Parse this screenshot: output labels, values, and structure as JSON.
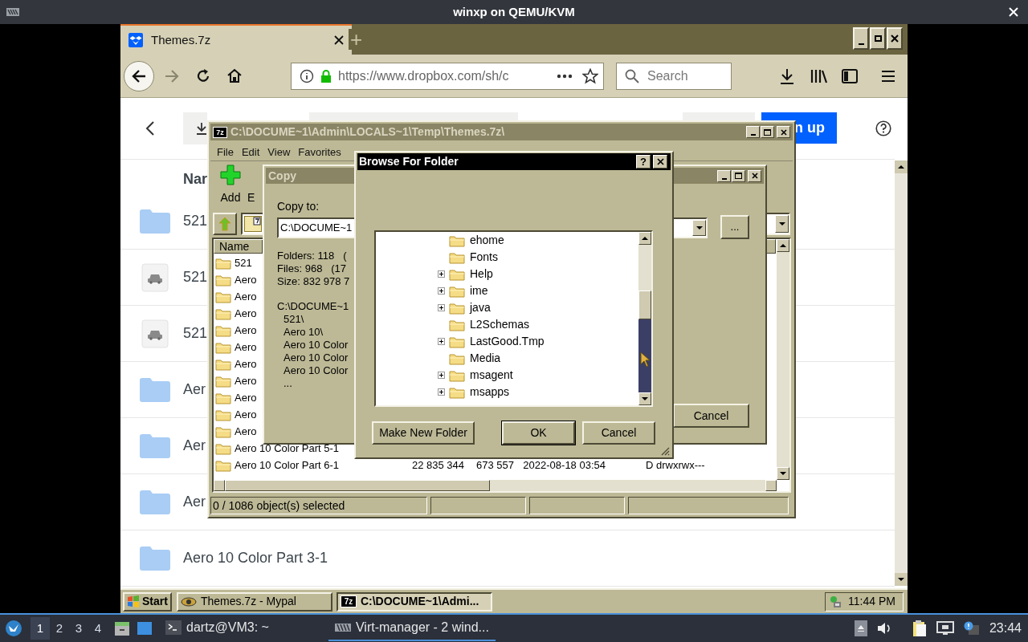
{
  "host_window": {
    "title": "winxp on QEMU/KVM"
  },
  "browser": {
    "tabs": [
      {
        "label": "Themes.7z",
        "selected": true
      }
    ],
    "new_tab": "+",
    "url": "https://www.dropbox.com/sh/c",
    "search": {
      "placeholder": "Search"
    }
  },
  "page": {
    "sign_up": "n up",
    "column_header": "Nar",
    "rows": [
      {
        "kind": "folder",
        "name": "521"
      },
      {
        "kind": "file",
        "name": "521"
      },
      {
        "kind": "file",
        "name": "521"
      },
      {
        "kind": "folder",
        "name": "Aer"
      },
      {
        "kind": "folder",
        "name": "Aer"
      },
      {
        "kind": "folder",
        "name": "Aer"
      },
      {
        "kind": "folder",
        "name": "Aero 10 Color Part 3-1"
      }
    ]
  },
  "archive_window": {
    "icon": "7z",
    "title": "C:\\DOCUME~1\\Admin\\LOCALS~1\\Temp\\Themes.7z\\",
    "menu": [
      "File",
      "Edit",
      "View",
      "Favorites"
    ],
    "toolbar": [
      "Add",
      "E"
    ],
    "columns": [
      "Name"
    ],
    "rows": [
      {
        "cells": [
          "521"
        ]
      },
      {
        "cells": [
          "Aero"
        ]
      },
      {
        "cells": [
          "Aero"
        ]
      },
      {
        "cells": [
          "Aero"
        ]
      },
      {
        "cells": [
          "Aero"
        ]
      },
      {
        "cells": [
          "Aero"
        ]
      },
      {
        "cells": [
          "Aero"
        ]
      },
      {
        "cells": [
          "Aero"
        ]
      },
      {
        "cells": [
          "Aero"
        ]
      },
      {
        "cells": [
          "Aero"
        ]
      },
      {
        "cells": [
          "Aero"
        ]
      },
      {
        "cells": [
          "Aero 10 Color Part 5-1"
        ]
      },
      {
        "cells": [
          "Aero 10 Color Part 6-1",
          "22 835 344",
          "673 557",
          "2022-08-18 03:54",
          "D drwxrwx---"
        ]
      }
    ],
    "status": "0 / 1086 object(s) selected"
  },
  "copy_dialog": {
    "title": "Copy",
    "label": "Copy to:",
    "path": "C:\\DOCUME~1",
    "browse": "...",
    "stats": [
      "Folders: 118   (",
      "Files: 968   (17",
      "Size: 832 978 7"
    ],
    "items": [
      "C:\\DOCUME~1",
      "521\\",
      "Aero 10\\",
      "Aero 10 Color",
      "Aero 10 Color",
      "Aero 10 Color",
      "..."
    ],
    "cancel": "Cancel"
  },
  "browse_dialog": {
    "title": "Browse For Folder",
    "help": "?",
    "tree": [
      {
        "label": "ehome",
        "expandable": false
      },
      {
        "label": "Fonts",
        "expandable": false
      },
      {
        "label": "Help",
        "expandable": true
      },
      {
        "label": "ime",
        "expandable": true
      },
      {
        "label": "java",
        "expandable": true
      },
      {
        "label": "L2Schemas",
        "expandable": false
      },
      {
        "label": "LastGood.Tmp",
        "expandable": true
      },
      {
        "label": "Media",
        "expandable": false
      },
      {
        "label": "msagent",
        "expandable": true
      },
      {
        "label": "msapps",
        "expandable": true
      }
    ],
    "buttons": [
      "Make New Folder",
      "OK",
      "Cancel"
    ]
  },
  "xp_taskbar": {
    "start": "Start",
    "tasks": [
      {
        "label": "Themes.7z - Mypal",
        "selected": false
      },
      {
        "label": "C:\\DOCUME~1\\Admi...",
        "selected": true,
        "icon": "7z"
      }
    ],
    "clock": "11:44 PM"
  },
  "host_taskbar": {
    "workspaces": [
      {
        "label": "1",
        "selected": true
      },
      {
        "label": "2",
        "selected": false
      },
      {
        "label": "3",
        "selected": false
      },
      {
        "label": "4",
        "selected": false
      }
    ],
    "tasks": [
      {
        "label": "dartz@VM3: ~",
        "selected": false
      },
      {
        "label": "Virt-manager - 2 wind...",
        "selected": true
      }
    ],
    "clock": "23:44"
  }
}
